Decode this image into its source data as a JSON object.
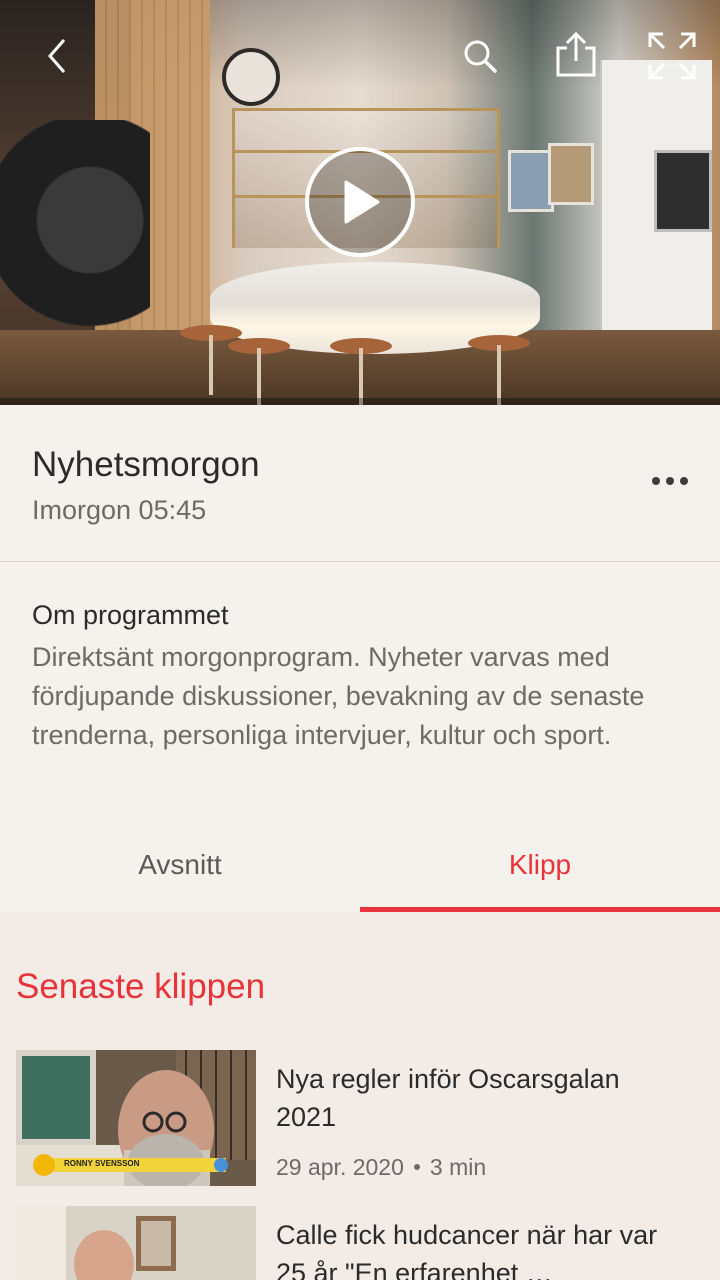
{
  "program": {
    "title": "Nyhetsmorgon",
    "airtime": "Imorgon 05:45"
  },
  "about": {
    "heading": "Om programmet",
    "description": "Direktsänt morgonprogram. Nyheter varvas med fördjupande diskussioner, bevakning av de senaste trenderna, personliga intervjuer, kultur och sport."
  },
  "tabs": [
    {
      "label": "Avsnitt",
      "selected": false
    },
    {
      "label": "Klipp",
      "selected": true
    }
  ],
  "clips_section": {
    "heading": "Senaste klippen",
    "items": [
      {
        "title": "Nya regler inför Oscarsgalan 2021",
        "date": "29 apr. 2020",
        "duration": "3 min",
        "thumb_caption": "RONNY SVENSSON"
      },
      {
        "title": "Calle fick hudcancer när har var 25 år \"En erfarenhet …",
        "date": "",
        "duration": ""
      }
    ]
  },
  "icons": {
    "back": "back-arrow-icon",
    "search": "search-icon",
    "share": "share-icon",
    "fullscreen": "fullscreen-icon",
    "play": "play-icon",
    "more": "more-icon"
  },
  "colors": {
    "accent": "#e8333b",
    "background": "#f5f1ec",
    "clips_background": "#f3ebe5"
  }
}
